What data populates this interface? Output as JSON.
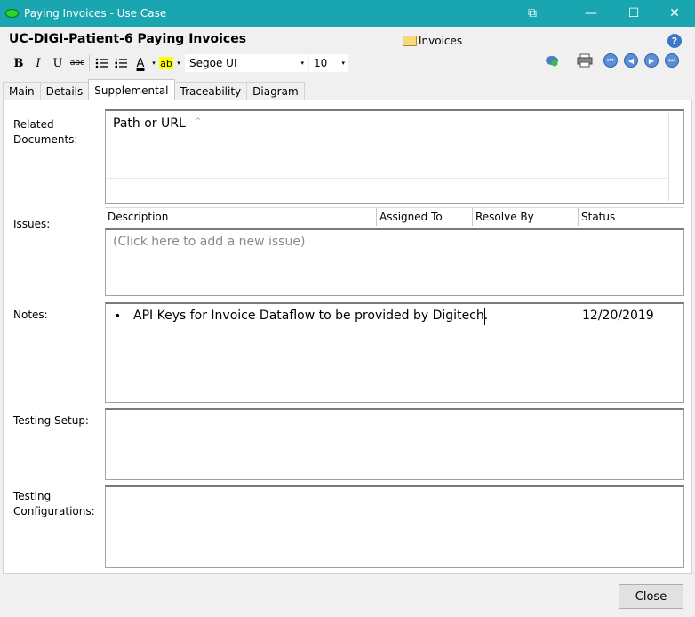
{
  "window": {
    "title": "Paying Invoices - Use Case",
    "controls": {
      "restore": "⧉",
      "minimize": "—",
      "maximize": "☐",
      "close": "✕"
    }
  },
  "header": {
    "title": "UC-DIGI-Patient-6 Paying Invoices",
    "folder": "Invoices",
    "help": "?"
  },
  "toolbar": {
    "bold": "B",
    "italic": "I",
    "underline": "U",
    "strike": "abc",
    "font_color": "A",
    "highlight": "ab",
    "font_name": "Segoe UI",
    "font_size": "10",
    "caret": "▾"
  },
  "tabs": [
    {
      "label": "Main"
    },
    {
      "label": "Details"
    },
    {
      "label": "Supplemental",
      "active": true
    },
    {
      "label": "Traceability"
    },
    {
      "label": "Diagram"
    }
  ],
  "supplemental": {
    "related_documents": {
      "label_line1": "Related",
      "label_line2": "Documents:",
      "placeholder": "Path or URL",
      "hint": "^"
    },
    "issues": {
      "label": "Issues:",
      "columns": [
        "Description",
        "Assigned To",
        "Resolve By",
        "Status"
      ],
      "placeholder": "(Click here to add a new issue)"
    },
    "notes": {
      "label": "Notes:",
      "bullet": "•",
      "text": "API Keys for Invoice Dataflow to be provided by Digitech.",
      "date": "12/20/2019"
    },
    "testing_setup": {
      "label": "Testing Setup:"
    },
    "testing_configurations": {
      "label_line1": "Testing",
      "label_line2": "Configurations:"
    }
  },
  "footer": {
    "close_label": "Close"
  },
  "colors": {
    "titlebar": "#1aa6b0",
    "app_icon": "#2bd42b",
    "nav_button": "#5a8fd6"
  }
}
